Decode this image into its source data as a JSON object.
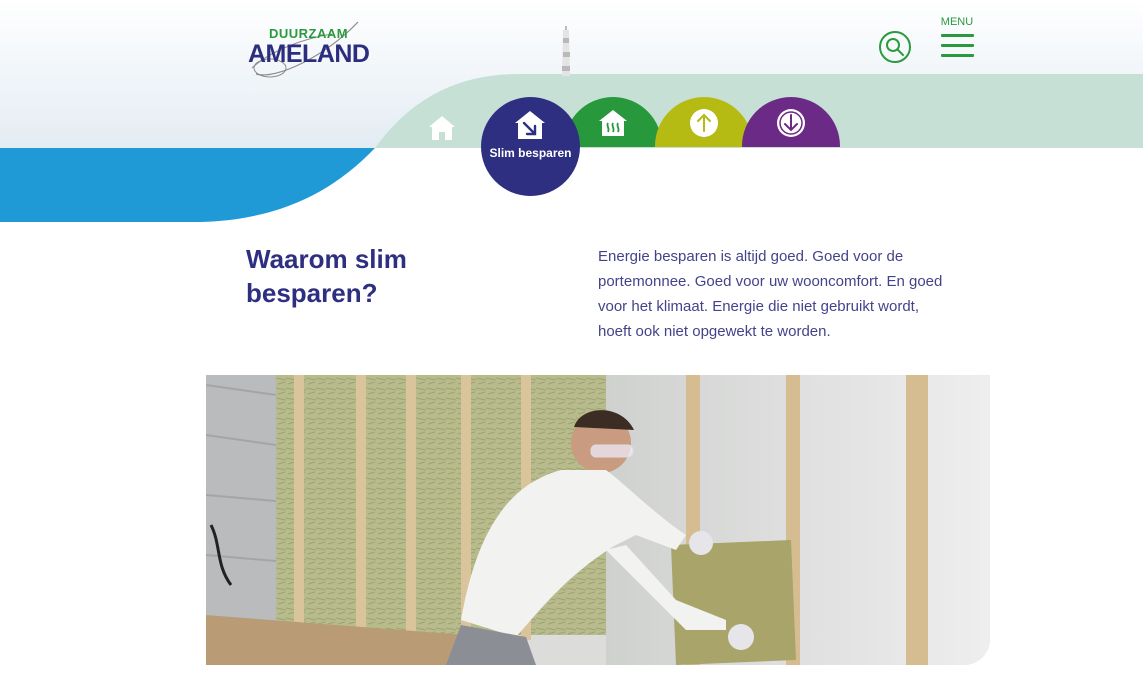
{
  "brand": {
    "logo_top": "DUURZAAM",
    "logo_main": "AMELAND"
  },
  "header": {
    "menu_label": "MENU",
    "search_icon": "search-icon",
    "menu_icon": "hamburger-icon"
  },
  "nav": {
    "items": [
      {
        "id": "home",
        "icon": "house-icon",
        "color": "#ffffff"
      },
      {
        "id": "slim-besparen",
        "label": "Slim besparen",
        "icon": "house-arrow-down-right-icon",
        "color": "#2f2f82",
        "active": true
      },
      {
        "id": "verwarmen",
        "icon": "house-heating-icon",
        "color": "#27993c"
      },
      {
        "id": "opwekken",
        "icon": "arrow-up-circle-icon",
        "color": "#b6bb14"
      },
      {
        "id": "besparen-omlaag",
        "icon": "arrow-down-circle-icon",
        "color": "#6b2a86"
      }
    ]
  },
  "intro": {
    "title": "Waarom slim besparen?",
    "text": "Energie besparen is altijd goed. Goed voor de portemonnee. Goed voor uw wooncomfort. En goed voor het klimaat. Energie die niet gebruikt wordt, hoeft ook niet opgewekt te worden."
  },
  "hero": {
    "image": "photo-worker-installing-insulation"
  },
  "colors": {
    "navy": "#2f2f82",
    "green": "#27993c",
    "mint": "#c6e0d6",
    "blue": "#1f9ad6",
    "lime": "#b6bb14",
    "purple": "#6b2a86"
  }
}
